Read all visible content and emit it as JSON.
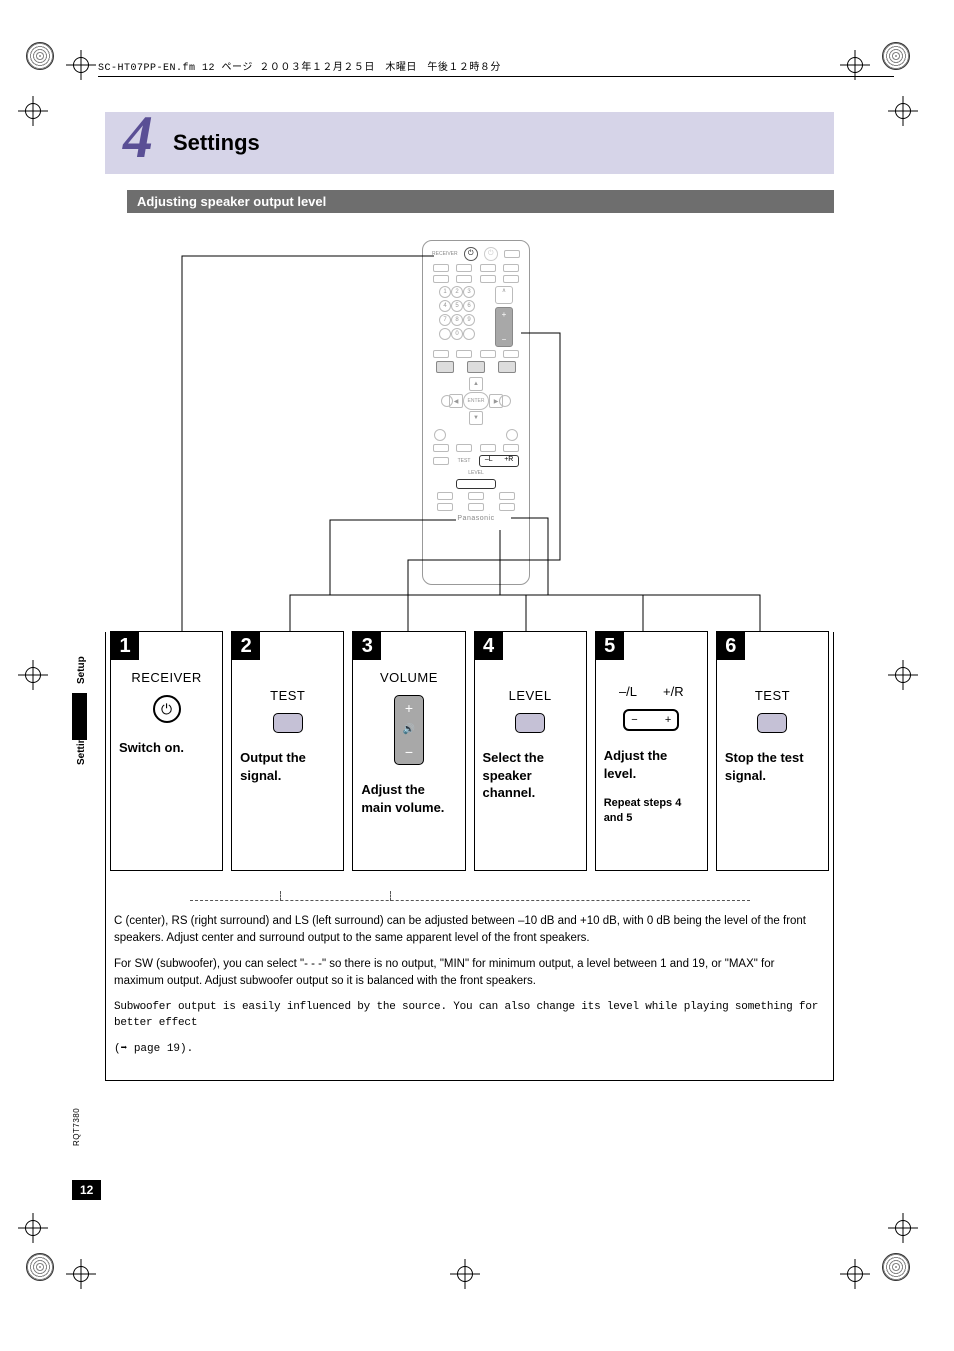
{
  "header_line": "SC-HT07PP-EN.fm  12 ページ  ２００３年１２月２５日　木曜日　午後１２時８分",
  "chapter": {
    "number": "4",
    "title": "Settings"
  },
  "section_title": "Adjusting speaker output level",
  "side_tabs": {
    "setup": "Setup",
    "settings": "Settings"
  },
  "remote": {
    "top_label": "RECEIVER",
    "ch_minus": "–L",
    "ch_plus": "+R",
    "test": "TEST",
    "level": "LEVEL",
    "brand": "Panasonic",
    "enter": "ENTER",
    "volume": "VOLUME"
  },
  "steps": [
    {
      "num": "1",
      "top": "RECEIVER",
      "action": "Switch on."
    },
    {
      "num": "2",
      "top": "TEST",
      "action": "Output the signal."
    },
    {
      "num": "3",
      "top": "VOLUME",
      "action": "Adjust the main volume."
    },
    {
      "num": "4",
      "top": "LEVEL",
      "action": "Select the speaker channel."
    },
    {
      "num": "5",
      "top_l": "–/L",
      "top_r": "+/R",
      "action": "Adjust the level.",
      "sub": "Repeat steps 4 and 5"
    },
    {
      "num": "6",
      "top": "TEST",
      "action": "Stop the test signal."
    }
  ],
  "notes": {
    "p1": "C (center), RS (right surround) and LS (left surround) can be adjusted between –10 dB and +10 dB, with 0 dB being the level of the front speakers. Adjust center and surround output to the same apparent level of the front speakers.",
    "p2": "For SW (subwoofer), you can select \"- - -\" so there is no output, \"MIN\" for minimum output, a level between 1 and 19, or \"MAX\" for maximum output. Adjust subwoofer output so it is balanced with the front speakers.",
    "p3": "Subwoofer output is easily influenced by the source. You can also change its level while playing something for better effect",
    "p4_prefix": "(➡ ",
    "p4_page": "page 19",
    "p4_suffix": ")."
  },
  "doc_code": "RQT7380",
  "page_number": "12"
}
